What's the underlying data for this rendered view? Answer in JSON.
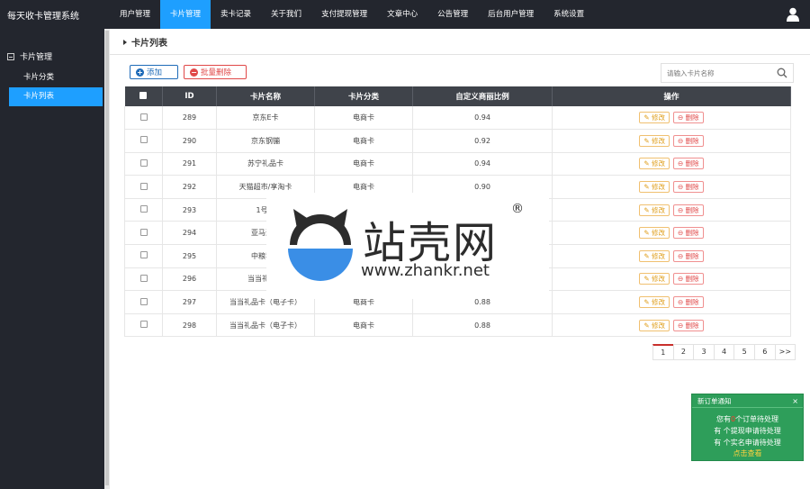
{
  "app": {
    "title": "每天收卡管理系统"
  },
  "nav": [
    {
      "label": "用户管理",
      "active": false
    },
    {
      "label": "卡片管理",
      "active": true
    },
    {
      "label": "卖卡记录",
      "active": false
    },
    {
      "label": "关于我们",
      "active": false
    },
    {
      "label": "支付提现管理",
      "active": false
    },
    {
      "label": "文章中心",
      "active": false
    },
    {
      "label": "公告管理",
      "active": false
    },
    {
      "label": "后台用户管理",
      "active": false
    },
    {
      "label": "系统设置",
      "active": false
    }
  ],
  "sidebar": {
    "group": "卡片管理",
    "items": [
      {
        "label": "卡片分类",
        "active": false
      },
      {
        "label": "卡片列表",
        "active": true
      }
    ]
  },
  "page": {
    "title": "卡片列表"
  },
  "toolbar": {
    "add_label": "添加",
    "bulk_delete_label": "批量删除"
  },
  "search": {
    "placeholder": "请输入卡片名称"
  },
  "table": {
    "headers": [
      "ID",
      "卡片名称",
      "卡片分类",
      "自定义商丽比例",
      "操作"
    ],
    "rows": [
      {
        "id": "289",
        "name": "京东E卡",
        "category": "电商卡",
        "ratio": "0.94"
      },
      {
        "id": "290",
        "name": "京东钢镚",
        "category": "电商卡",
        "ratio": "0.92"
      },
      {
        "id": "291",
        "name": "苏宁礼品卡",
        "category": "电商卡",
        "ratio": "0.94"
      },
      {
        "id": "292",
        "name": "天猫超市/享淘卡",
        "category": "电商卡",
        "ratio": "0.90"
      },
      {
        "id": "293",
        "name": "1号店",
        "category": "",
        "ratio": ""
      },
      {
        "id": "294",
        "name": "亚马逊（",
        "category": "",
        "ratio": ""
      },
      {
        "id": "295",
        "name": "中粮我买",
        "category": "",
        "ratio": ""
      },
      {
        "id": "296",
        "name": "当当礼品卡",
        "category": "",
        "ratio": ""
      },
      {
        "id": "297",
        "name": "当当礼品卡（电子卡）",
        "category": "电商卡",
        "ratio": "0.88"
      },
      {
        "id": "298",
        "name": "当当礼品卡（电子卡）",
        "category": "电商卡",
        "ratio": "0.88"
      }
    ],
    "edit_label": "修改",
    "delete_label": "删除"
  },
  "pagination": {
    "pages": [
      "1",
      "2",
      "3",
      "4",
      "5",
      "6"
    ],
    "next": ">>",
    "current": "1"
  },
  "notice": {
    "title": "新订单通知",
    "close": "×",
    "line1_prefix": "您有",
    "line1_num": "0",
    "line1_suffix": "个订单待处理",
    "line2": "有  个提现申请待处理",
    "line3": "有  个实名申请待处理",
    "link": "点击查看"
  },
  "watermark": {
    "text": "站壳网",
    "url": "www.zhankr.net",
    "reg": "®"
  },
  "colors": {
    "nav_bg": "#23262e",
    "accent": "#1e9fff",
    "header_bg": "#3f434a",
    "notice_bg": "#2e9e5a",
    "danger": "#e04848",
    "warn": "#e0a020"
  }
}
